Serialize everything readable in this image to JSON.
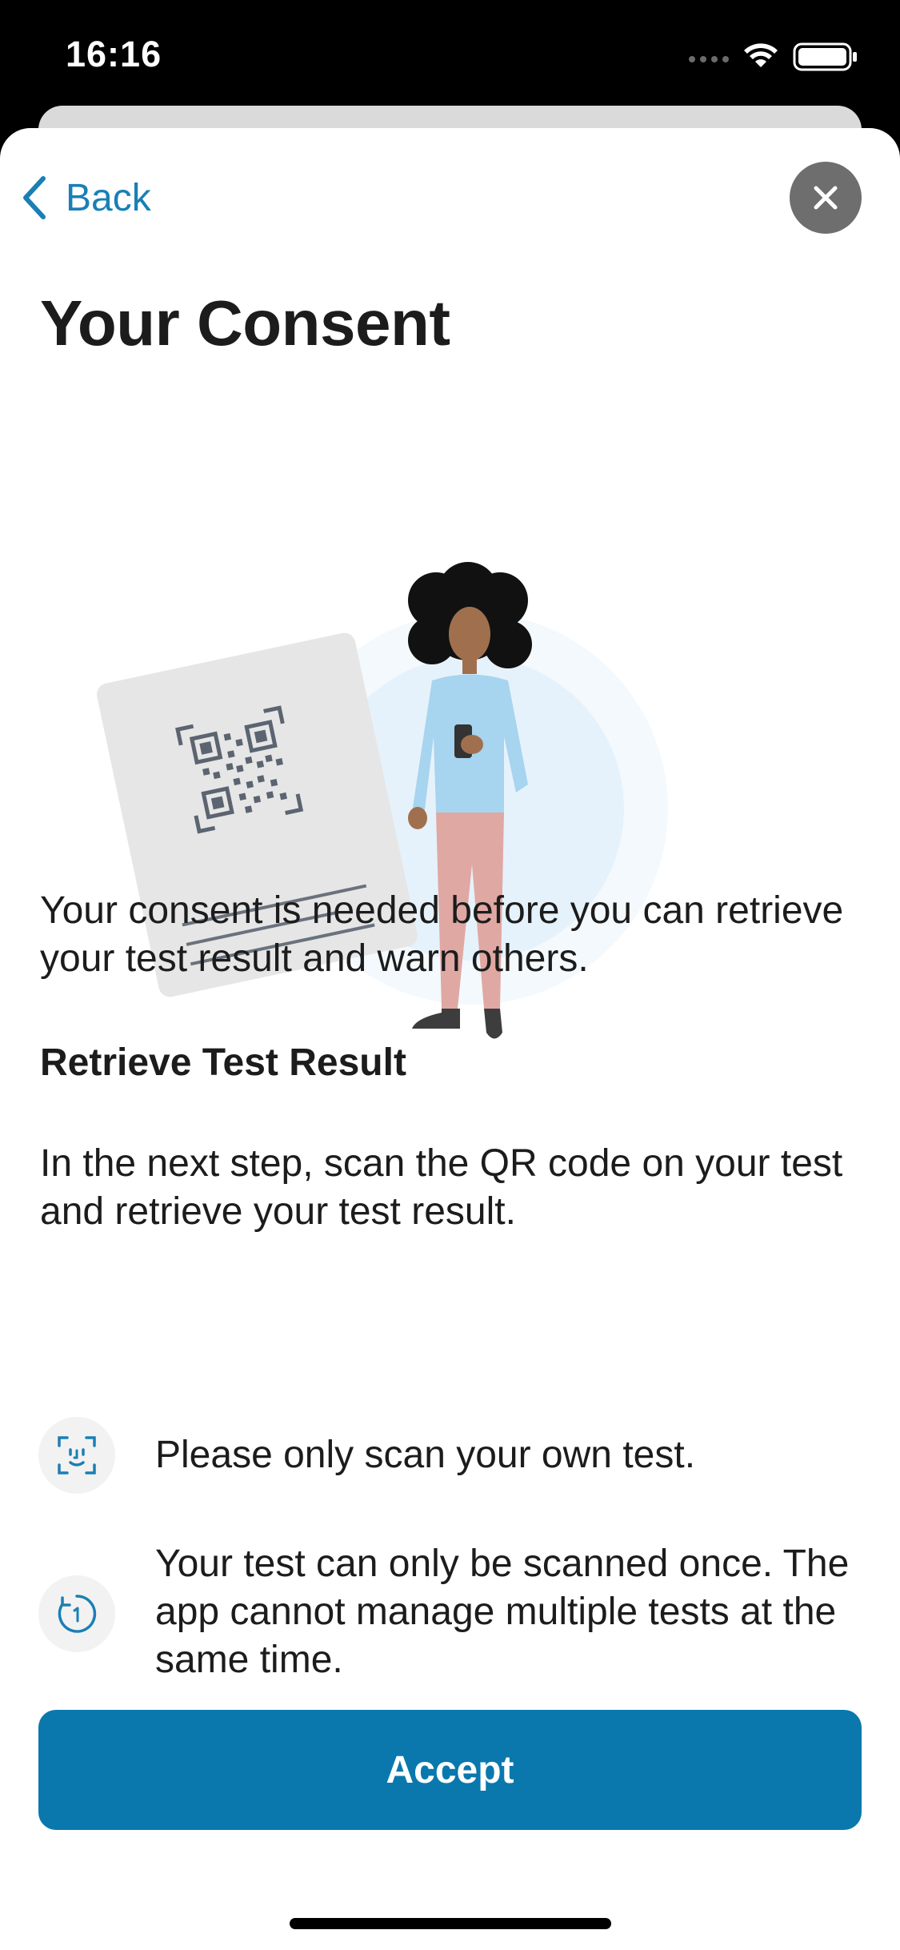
{
  "status_bar": {
    "time": "16:16",
    "icons": [
      "signal-dots-icon",
      "wifi-icon",
      "battery-icon"
    ]
  },
  "nav": {
    "back_label": "Back",
    "back_icon": "chevron-left-icon",
    "close_icon": "close-icon"
  },
  "page": {
    "title": "Your Consent",
    "intro": "Your consent is needed before you can retrieve your test result and warn others.",
    "section_heading": "Retrieve Test Result",
    "section_body": "In the next step, scan the QR code on your test and retrieve your test result.",
    "bullets": [
      {
        "icon": "face-scan-icon",
        "text": "Please only scan your own test."
      },
      {
        "icon": "timer-one-icon",
        "text": "Your test can only be scanned once. The app cannot manage multiple tests at the same time."
      }
    ]
  },
  "actions": {
    "accept_label": "Accept"
  },
  "colors": {
    "accent": "#1a7fb5",
    "button": "#0a78ad",
    "close_button": "#6e6e6e",
    "text": "#1c1c1c"
  }
}
